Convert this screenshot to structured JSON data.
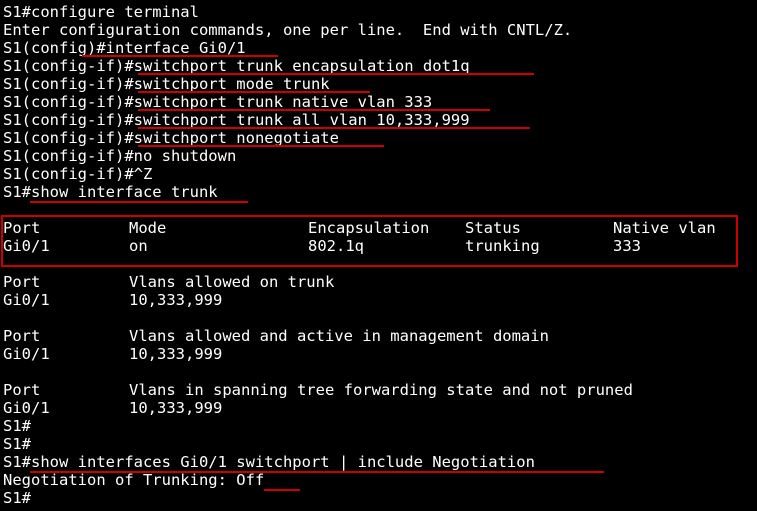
{
  "window": {
    "title": ""
  },
  "terminal": {
    "lines": [
      "S1#configure terminal",
      "Enter configuration commands, one per line.  End with CNTL/Z.",
      "S1(config)#interface Gi0/1",
      "S1(config-if)#switchport trunk encapsulation dot1q",
      "S1(config-if)#switchport mode trunk",
      "S1(config-if)#switchport trunk native vlan 333",
      "S1(config-if)#switchport trunk all vlan 10,333,999",
      "S1(config-if)#switchport nonegotiate",
      "S1(config-if)#no shutdown",
      "S1(config-if)#^Z",
      "S1#show interface trunk"
    ],
    "trunk_table": {
      "headers": [
        "Port",
        "Mode",
        "Encapsulation",
        "Status",
        "Native vlan"
      ],
      "row": [
        "Gi0/1",
        "on",
        "802.1q",
        "trunking",
        "333"
      ]
    },
    "allowed_sections": [
      {
        "header_port": "Port",
        "header_desc": "Vlans allowed on trunk",
        "port": "Gi0/1",
        "vlans": "10,333,999"
      },
      {
        "header_port": "Port",
        "header_desc": "Vlans allowed and active in management domain",
        "port": "Gi0/1",
        "vlans": "10,333,999"
      },
      {
        "header_port": "Port",
        "header_desc": "Vlans in spanning tree forwarding state and not pruned",
        "port": "Gi0/1",
        "vlans": "10,333,999"
      }
    ],
    "tail_lines": [
      "S1#",
      "S1#",
      "S1#show interfaces Gi0/1 switchport | include Negotiation",
      "Negotiation of Trunking: Off",
      "S1#"
    ]
  },
  "colors": {
    "background": "#000000",
    "text": "#ffffff",
    "highlight": "#cc0000"
  }
}
